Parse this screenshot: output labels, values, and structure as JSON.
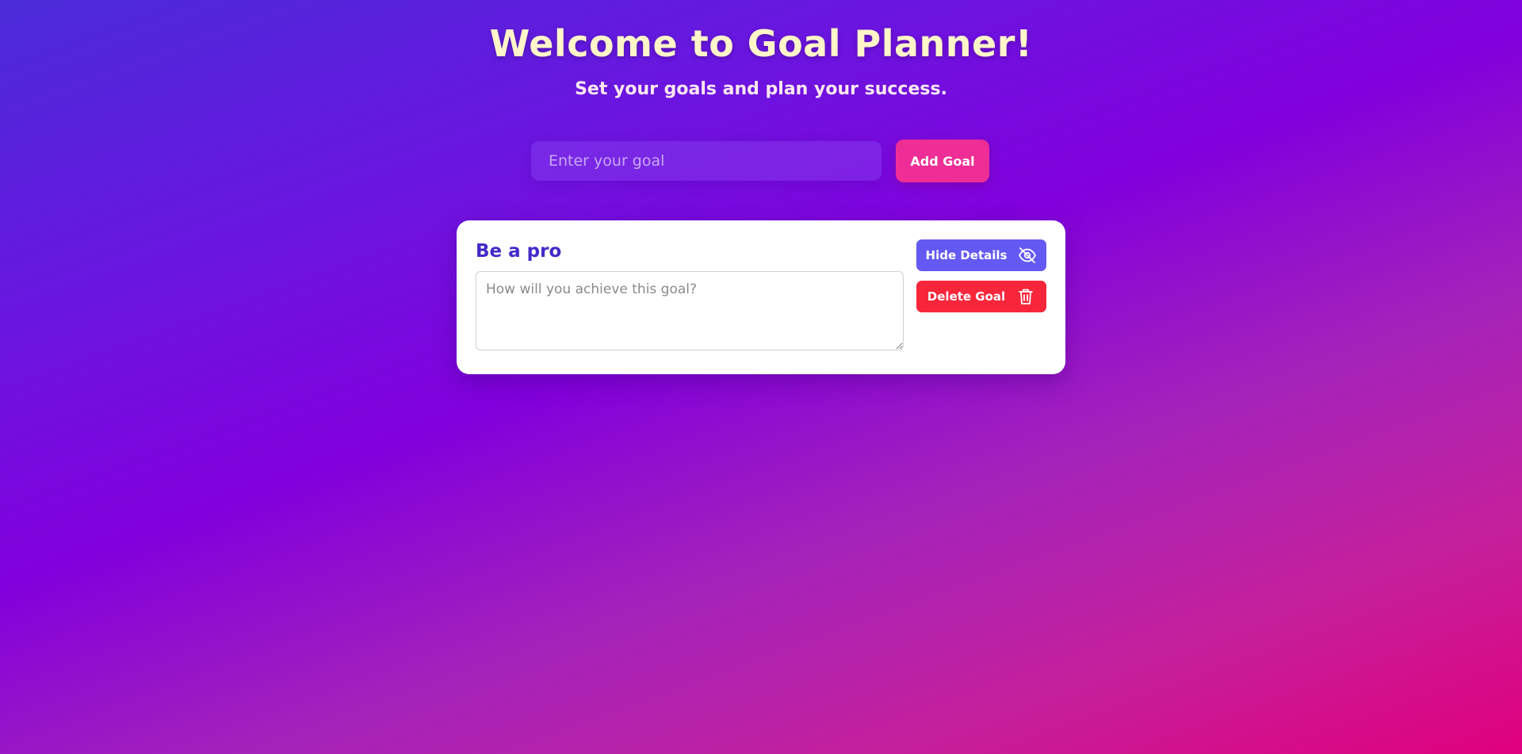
{
  "header": {
    "title": "Welcome to Goal Planner!",
    "subtitle": "Set your goals and plan your success."
  },
  "add_goal": {
    "input_placeholder": "Enter your goal",
    "input_value": "",
    "button_label": "Add Goal"
  },
  "goals": [
    {
      "title": "Be a pro",
      "notes_placeholder": "How will you achieve this goal?",
      "notes_value": "",
      "hide_details_label": "Hide Details",
      "hide_details_icon": "eye-off-icon",
      "delete_label": "Delete Goal",
      "delete_icon": "trash-icon"
    }
  ],
  "colors": {
    "title": "#fff5c9",
    "add_button": "#ee2e96",
    "hide_button": "#6459f2",
    "delete_button": "#f7263b",
    "goal_title": "#4529c8"
  }
}
